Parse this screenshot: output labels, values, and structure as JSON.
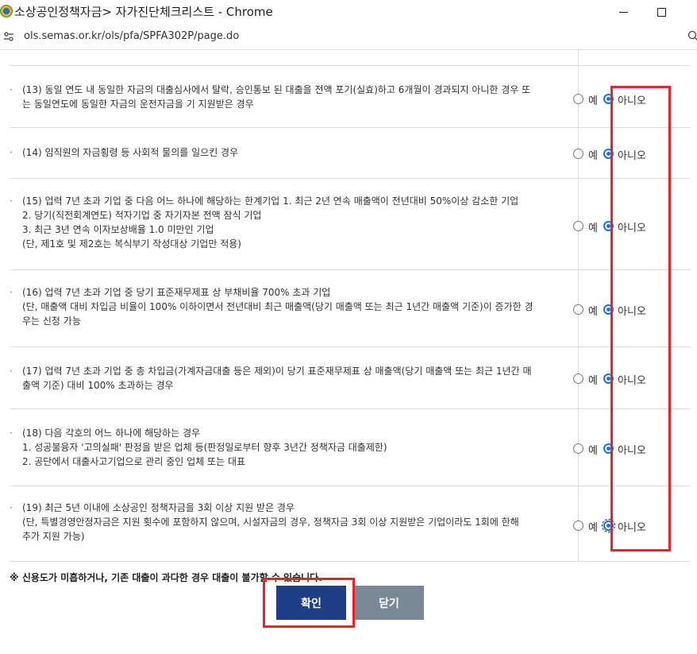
{
  "window": {
    "title": "소상공인정책자금> 자가진단체크리스트 - Chrome"
  },
  "address_bar": {
    "url": "ols.semas.or.kr/ols/pfa/SPFA302P/page.do"
  },
  "answer_labels": {
    "yes": "예",
    "no": "아니오"
  },
  "questions": [
    {
      "lines": [
        "(13) 동일 연도 내 동일한 자금의 대출심사에서 탈락, 승인통보 된 대출을 전액 포기(실효)하고 6개월이 경과되지 아니한 경우 또",
        "는 동일연도에 동일한 자금의 운전자금을 기 지원받은 경우"
      ],
      "selected": "no"
    },
    {
      "lines": [
        "(14) 임직원의 자금횡령 등 사회적 물의를 일으킨 경우"
      ],
      "selected": "no"
    },
    {
      "lines": [
        "(15) 업력 7년 초과 기업 중 다음 어느 하나에 해당하는 한계기업 1. 최근 2년 연속 매출액이 전년대비 50%이상 감소한 기업",
        "2. 당기(직전회계연도) 적자기업 중 자기자본 전액 잠식 기업",
        "3. 최근 3년 연속 이자보상배율 1.0 미만인 기업",
        "(단, 제1호 및 제2호는 복식부기 작성대상 기업만 적용)"
      ],
      "selected": "no"
    },
    {
      "lines": [
        "(16) 업력 7년 초과 기업 중 당기 표준재무제표 상 부채비율 700% 초과 기업",
        "(단, 매출액 대비 차입금 비율이 100% 이하이면서 전년대비 최근 매출액(당기 매출액 또는 최근 1년간 매출액 기준)이 증가한 경",
        "우는 신청 가능"
      ],
      "selected": "no"
    },
    {
      "lines": [
        "(17) 업력 7년 초과 기업 중 총 차입금(가계자금대출 등은 제외)이 당기 표준재무제표 상 매출액(당기 매출액 또는 최근 1년간 매",
        "출액 기준) 대비 100% 초과하는 경우"
      ],
      "selected": "no"
    },
    {
      "lines": [
        "(18) 다음 각호의 어느 하나에 해당하는 경우",
        "1. 성공불융자 '고의실패' 판정을 받은 업체 등(판정일로부터 향후 3년간 정책자금 대출제한)",
        "2. 공단에서 대출사고기업으로 관리 중인 업체 또는 대표"
      ],
      "selected": "no"
    },
    {
      "lines": [
        "(19) 최근 5년 이내에 소상공인 정책자금을 3회 이상 지원 받은 경우",
        "(단, 특별경영안정자금은 지원 횟수에 포함하지 않으며, 시설자금의 경우, 정책자금 3회 이상 지원받은 기업이라도 1회에 한해",
        "추가 지원 가능)"
      ],
      "selected": "no"
    }
  ],
  "notice": "※ 신용도가 미흡하거나, 기존 대출이 과다한 경우 대출이 불가할 수 있습니다.",
  "buttons": {
    "confirm": "확인",
    "close": "닫기"
  },
  "colors": {
    "confirm_bg": "#1e3f86",
    "close_bg": "#7b8898",
    "highlight": "#ec2227",
    "radio_checked": "#1a73e8"
  }
}
